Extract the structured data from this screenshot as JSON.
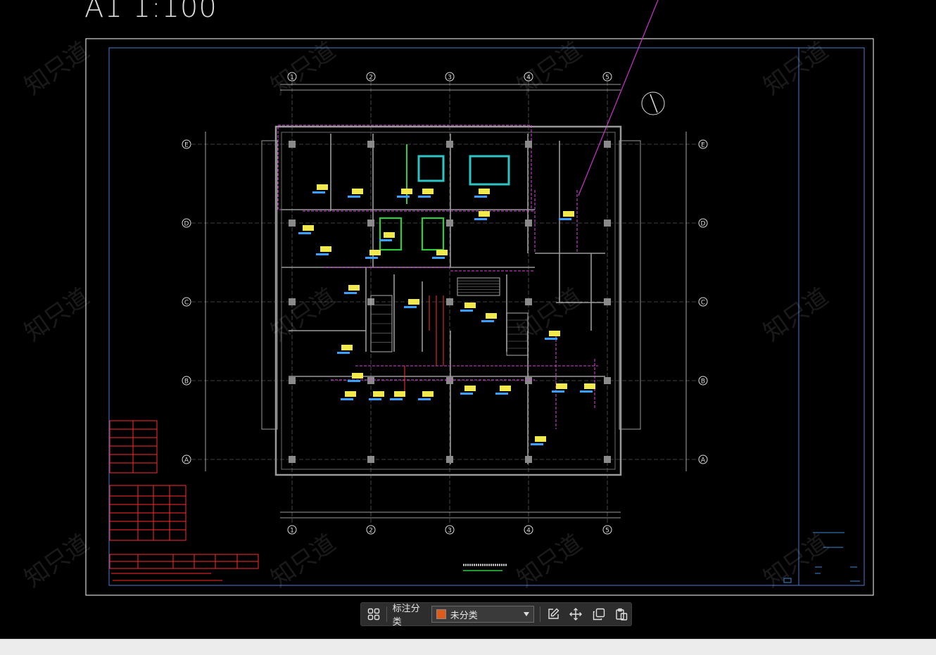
{
  "drawing": {
    "scale_label": "A1 1:100",
    "watermark_text": "知只道",
    "grid_numbers": [
      "1",
      "2",
      "3",
      "4",
      "5"
    ],
    "grid_letters": [
      "E",
      "D",
      "C",
      "B",
      "A"
    ],
    "colors": {
      "background": "#000000",
      "frame": "#ffffff",
      "inner_frame": "#4a7bd0",
      "walls": "#a0a0a0",
      "magenta": "#e040e0",
      "yellow": "#f2e94e",
      "cyan": "#3aa0ff",
      "red": "#ff2a2a",
      "green": "#2ecc40"
    }
  },
  "toolbar": {
    "grid_icon": "grid-icon",
    "category_label": "标注分类",
    "selected_category": "未分类",
    "selected_color": "#e05a1a",
    "icons": [
      "edit-icon",
      "move-icon",
      "copy-icon",
      "paste-icon"
    ]
  }
}
